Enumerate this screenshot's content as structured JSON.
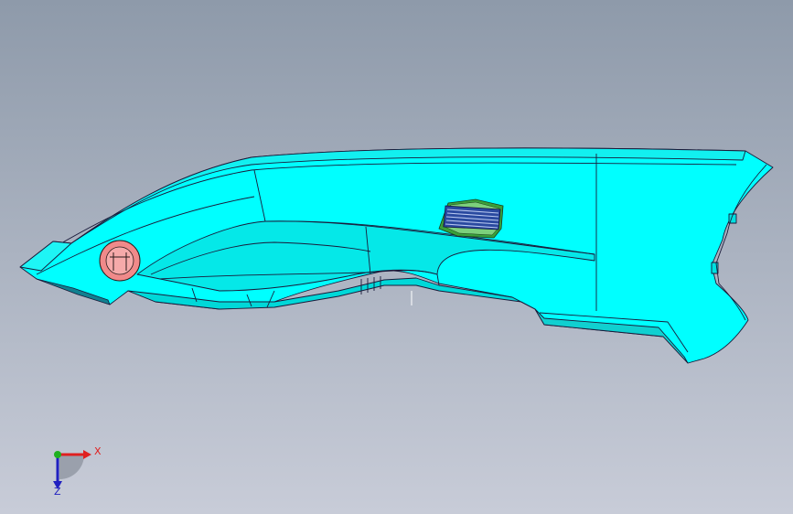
{
  "viewport": {
    "background_top": "#8e9aaa",
    "background_bottom": "#c8ccd8"
  },
  "model": {
    "body_color": "#00ffff",
    "edge_color": "#1a1a3a",
    "badge_color": "#f08a8a",
    "vent_color": "#2a4aa0",
    "vent_bezel_color": "#3aa03a"
  },
  "triad": {
    "x_label": "X",
    "z_label": "Z",
    "x_color": "#e02020",
    "y_color": "#20b020",
    "z_color": "#2020c0"
  }
}
